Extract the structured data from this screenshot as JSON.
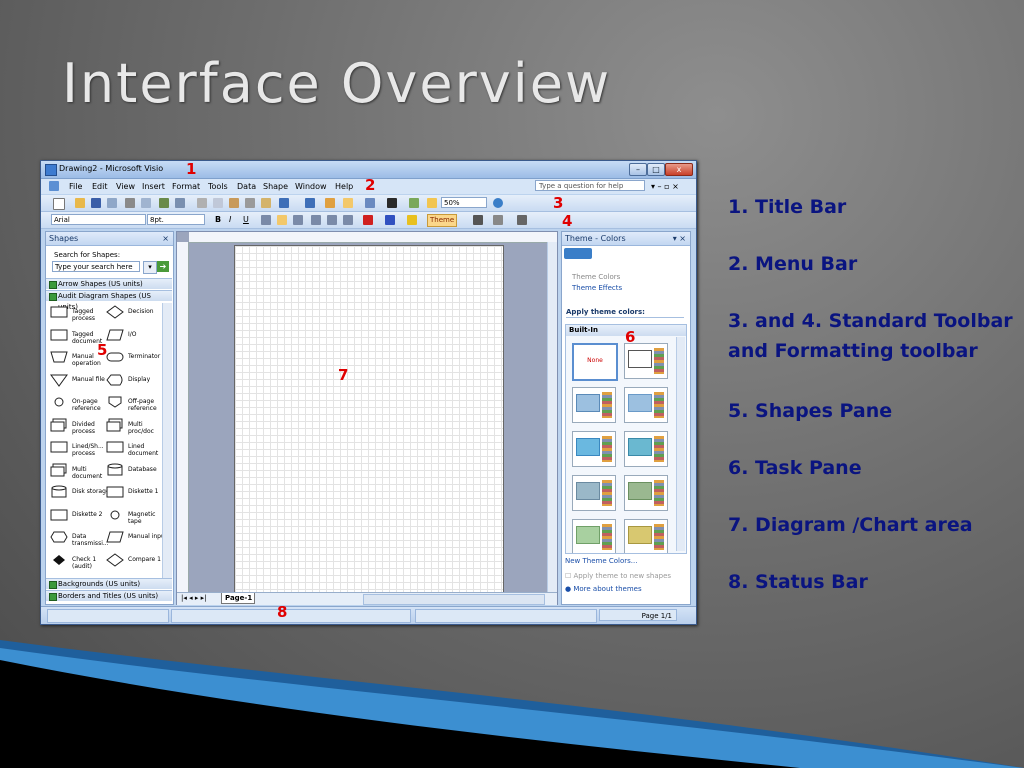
{
  "slide": {
    "title": "Interface Overview"
  },
  "window": {
    "title": "Drawing2 - Microsoft Visio",
    "menu": [
      "File",
      "Edit",
      "View",
      "Insert",
      "Format",
      "Tools",
      "Data",
      "Shape",
      "Window",
      "Help"
    ],
    "ask_placeholder": "Type a question for help",
    "std_zoom": "50%",
    "font_name": "Arial",
    "font_size": "8pt.",
    "theme_button": "Theme"
  },
  "shapes_pane": {
    "title": "Shapes",
    "search_label": "Search for Shapes:",
    "search_placeholder": "Type your search here",
    "stencils_top": [
      "Arrow Shapes (US units)",
      "Audit Diagram Shapes (US units)"
    ],
    "stencils_bottom": [
      "Backgrounds (US units)",
      "Borders and Titles (US units)"
    ],
    "items": [
      [
        "Tagged process",
        "Decision"
      ],
      [
        "Tagged document",
        "I/O"
      ],
      [
        "Manual operation",
        "Terminator"
      ],
      [
        "Manual file",
        "Display"
      ],
      [
        "On-page reference",
        "Off-page reference"
      ],
      [
        "Divided process",
        "Multi proc/doc"
      ],
      [
        "Lined/Sh... process",
        "Lined document"
      ],
      [
        "Multi document",
        "Database"
      ],
      [
        "Disk storage",
        "Diskette 1"
      ],
      [
        "Diskette 2",
        "Magnetic tape"
      ],
      [
        "Data transmissi...",
        "Manual input"
      ],
      [
        "Check 1 (audit)",
        "Compare 1"
      ]
    ]
  },
  "drawing": {
    "page_tab": "Page-1"
  },
  "task_pane": {
    "title": "Theme - Colors",
    "links": [
      "Theme Colors",
      "Theme Effects"
    ],
    "section": "Apply theme colors:",
    "group": "Built-In",
    "none_label": "None",
    "new_colors": "New Theme Colors...",
    "apply_new": "Apply theme to new shapes",
    "more": "More about themes"
  },
  "status": {
    "page": "Page 1/1"
  },
  "numbers": [
    "1",
    "2",
    "3",
    "4",
    "5",
    "6",
    "7",
    "8"
  ],
  "legend": [
    "1. Title Bar",
    "2.  Menu Bar",
    "3. and 4.  Standard Toolbar",
    "and Formatting toolbar",
    "5.  Shapes Pane",
    "6.  Task Pane",
    "7.  Diagram /Chart area",
    "8.  Status Bar"
  ]
}
